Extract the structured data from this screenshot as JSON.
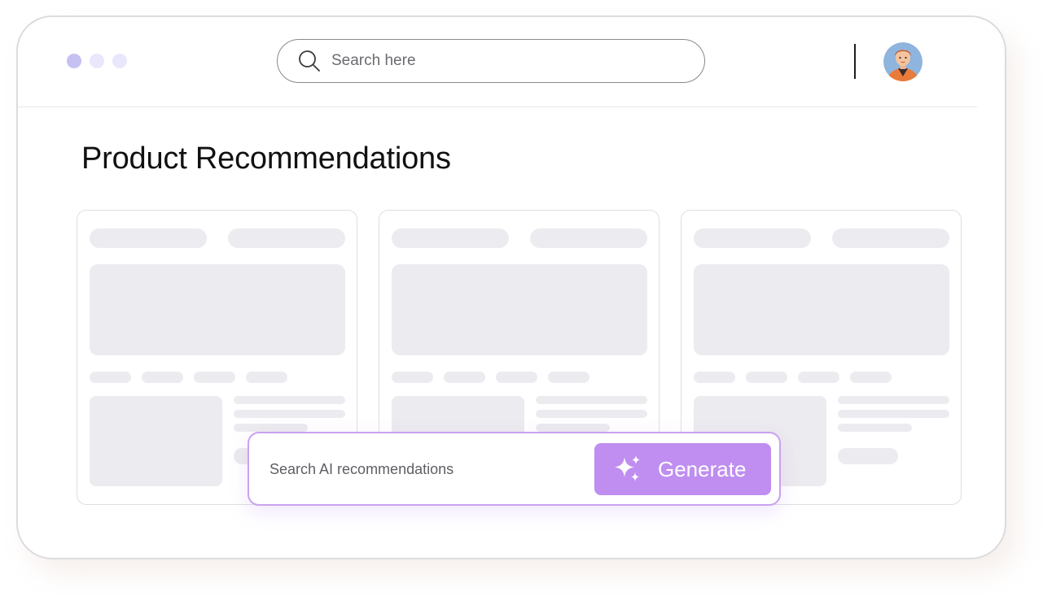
{
  "window_controls": [
    "dot-1",
    "dot-2",
    "dot-3"
  ],
  "header": {
    "search": {
      "placeholder": "Search here",
      "icon": "search-icon"
    },
    "avatar_icon": "user-avatar"
  },
  "main": {
    "title": "Product Recommendations",
    "cards": [
      {
        "state": "loading-skeleton"
      },
      {
        "state": "loading-skeleton"
      },
      {
        "state": "loading-skeleton"
      }
    ]
  },
  "ai_search": {
    "placeholder": "Search AI recommendations",
    "button_label": "Generate",
    "button_icon": "sparkles-icon"
  },
  "colors": {
    "accent": "#bf8ef0",
    "accent_border": "#c9a2ef",
    "window_dot_active": "#c6c1f3",
    "window_dot_inactive": "#e9e7fb",
    "skeleton": "#ecebef"
  }
}
